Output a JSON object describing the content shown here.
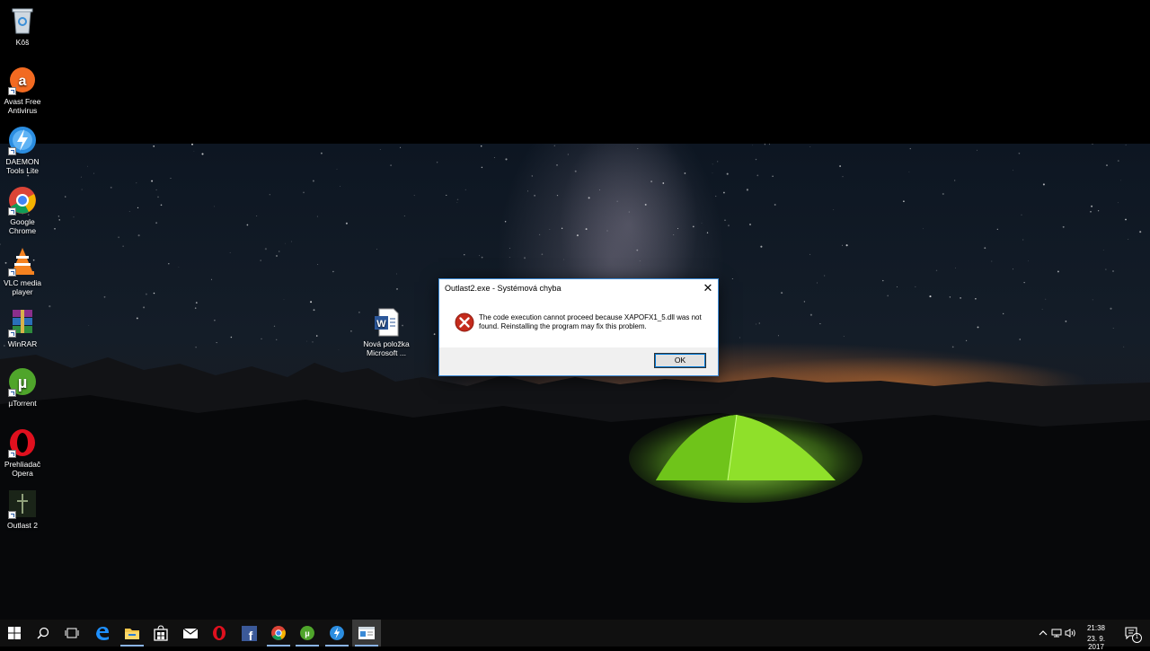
{
  "desktop": {
    "icons": [
      {
        "label": "Kôš",
        "icon": "recycle-bin-icon"
      },
      {
        "label": "Avast Free Antivirus",
        "icon": "avast-icon"
      },
      {
        "label": "DAEMON Tools Lite",
        "icon": "daemon-tools-icon"
      },
      {
        "label": "Google Chrome",
        "icon": "chrome-icon"
      },
      {
        "label": "VLC media player",
        "icon": "vlc-icon"
      },
      {
        "label": "WinRAR",
        "icon": "winrar-icon"
      },
      {
        "label": "µTorrent",
        "icon": "utorrent-icon"
      },
      {
        "label": "Prehliadač Opera",
        "icon": "opera-icon"
      },
      {
        "label": "Outlast 2",
        "icon": "outlast-icon"
      }
    ],
    "document_icon": {
      "label": "Nová položka Microsoft ...",
      "icon": "word-document-icon"
    }
  },
  "dialog": {
    "title": "Outlast2.exe - Systémová chyba",
    "message": "The code execution cannot proceed because XAPOFX1_5.dll was not found. Reinstalling the program may fix this problem.",
    "ok_label": "OK",
    "close_glyph": "✕"
  },
  "taskbar": {
    "time": "21:38",
    "date": "23. 9. 2017",
    "notification_count": "1",
    "items": [
      "start-icon",
      "search-icon",
      "task-view-icon",
      "edge-icon",
      "file-explorer-icon",
      "store-icon",
      "mail-icon",
      "opera-icon",
      "facebook-icon",
      "chrome-icon",
      "utorrent-icon",
      "daemon-tools-icon",
      "error-window-icon"
    ]
  },
  "colors": {
    "accent": "#0078d7",
    "error": "#c42b1c",
    "tent": "#7ed321"
  }
}
